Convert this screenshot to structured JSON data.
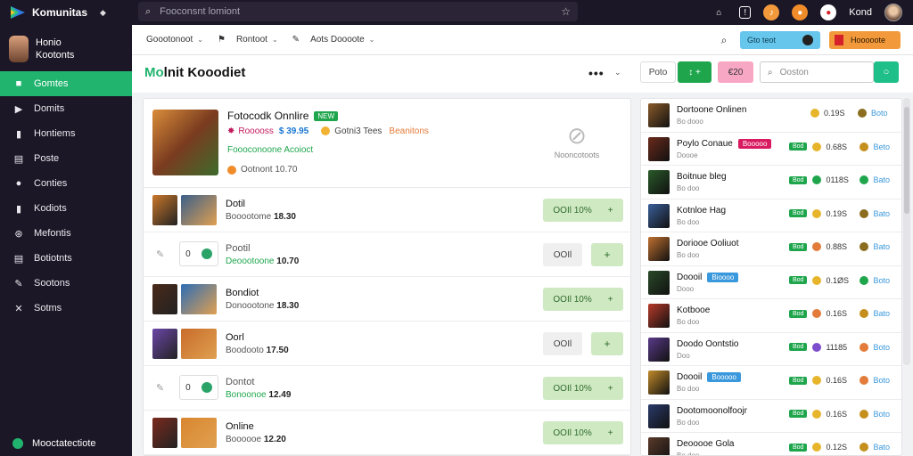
{
  "app": {
    "name": "Komunitas"
  },
  "topbar": {
    "search_placeholder": "Fooconsnt lomiont",
    "username": "Kond"
  },
  "sidebar": {
    "user": {
      "line1": "Honio",
      "line2": "Kootonts"
    },
    "items": [
      {
        "label": "Gomtes",
        "icon": "■",
        "active": true
      },
      {
        "label": "Domits",
        "icon": "▶"
      },
      {
        "label": "Hontiems",
        "icon": "▮"
      },
      {
        "label": "Poste",
        "icon": "▤"
      },
      {
        "label": "Conties",
        "icon": "●"
      },
      {
        "label": "Kodiots",
        "icon": "▮"
      },
      {
        "label": "Mefontis",
        "icon": "⊛"
      },
      {
        "label": "Botiotnts",
        "icon": "▤"
      },
      {
        "label": "Sootons",
        "icon": "✎"
      },
      {
        "label": "Sotms",
        "icon": "✕"
      }
    ],
    "footer": "Mooctatectiote"
  },
  "subbar": {
    "item1": "Goootonoot",
    "item2": "Rontoot",
    "item3": "Aots Doooote",
    "blue_pill": "Gto teot",
    "orange_pill": "Hooooote"
  },
  "titlebar": {
    "title_prefix": "Mo",
    "title_rest": "lnit Kooodiet",
    "dots": "•••",
    "btn_white": "Poto",
    "btn_green": "↕ +",
    "btn_pink": "€20",
    "search_placeholder": "Ooston"
  },
  "featured": {
    "title": "Fotocodk Onnlire",
    "badge": "NEW",
    "price_pink": "Rooooss",
    "price_blue": "$ 39.95",
    "meta_gray": "Gotni3 Tees",
    "meta_orange": "Beanitons",
    "green_line": "Foooconoone Acoioct",
    "bottom": "Ootnont 10.70",
    "side_icon": "⊘",
    "side_label": "Nooncotoots"
  },
  "rows": [
    {
      "name": "Dotil",
      "price_label": "Booootome",
      "price": "18.30",
      "variant": "thumbs",
      "btn_label": "OOIl 10%",
      "btn_plus": "+"
    },
    {
      "name": "Pootil",
      "price_label": "Deoootoone",
      "price": "10.70",
      "variant": "box",
      "box_value": "0",
      "btn_label": "OOIl",
      "btn_plus": "+"
    },
    {
      "name": "Bondiot",
      "price_label": "Donoootone",
      "price": "18.30",
      "variant": "thumbs",
      "btn_label": "OOIl 10%",
      "btn_plus": "+"
    },
    {
      "name": "Oorl",
      "price_label": "Boodooto",
      "price": "17.50",
      "variant": "thumbs",
      "btn_label": "OOIl",
      "btn_plus": "+"
    },
    {
      "name": "Dontot",
      "price_label": "Bonoonoe",
      "price": "12.49",
      "variant": "box",
      "box_value": "0",
      "btn_label": "OOIl 10%",
      "btn_plus": "+"
    },
    {
      "name": "Online",
      "price_label": "Boooooe",
      "price": "12.20",
      "variant": "thumbs",
      "btn_label": "OOIl 10%",
      "btn_plus": "+"
    }
  ],
  "rpanel": [
    {
      "name": "Dortoone Onlinen",
      "sub": "Bo dooo",
      "tag": "",
      "v1": "0.19S",
      "v2": "Boto",
      "c1": "#e7b52c",
      "c2": "#8a6d1f",
      "g": false
    },
    {
      "name": "Poylo Conaue",
      "sub": "Doooe",
      "tag": "Booooo",
      "tagc": "red",
      "v1": "0.68S",
      "v2": "Beto",
      "c1": "#e7b52c",
      "c2": "#c58f1d",
      "g": true
    },
    {
      "name": "Boitnue bleg",
      "sub": "Bo doo",
      "tag": "",
      "v1": "0118S",
      "v2": "Bato",
      "c1": "#1fa64d",
      "c2": "#1fa64d",
      "g": true
    },
    {
      "name": "Kotnloe Hag",
      "sub": "Bo doo",
      "tag": "",
      "v1": "0.19S",
      "v2": "Bato",
      "c1": "#e7b52c",
      "c2": "#8a6d1f",
      "g": true
    },
    {
      "name": "Doriooe Ooliuot",
      "sub": "Bo doo",
      "tag": "",
      "v1": "0.88S",
      "v2": "Bato",
      "c1": "#e37b3a",
      "c2": "#8a6d1f",
      "g": true
    },
    {
      "name": "Doooil",
      "sub": "Dooo",
      "tag": "Bioooo",
      "tagc": "blue",
      "v1": "0.1ØS",
      "v2": "Boto",
      "c1": "#e7b52c",
      "c2": "#1fa64d",
      "g": true
    },
    {
      "name": "Kotbooe",
      "sub": "Bo doo",
      "tag": "",
      "v1": "0.16S",
      "v2": "Bato",
      "c1": "#e37b3a",
      "c2": "#c58f1d",
      "g": true
    },
    {
      "name": "Doodo Oontstio",
      "sub": "Doo",
      "tag": "",
      "v1": "11185",
      "v2": "Boto",
      "c1": "#7c4dcc",
      "c2": "#e37b3a",
      "g": true
    },
    {
      "name": "Doooil",
      "sub": "Bo doo",
      "tag": "Booooo",
      "tagc": "blue",
      "v1": "0.16S",
      "v2": "Boto",
      "c1": "#e7b52c",
      "c2": "#e37b3a",
      "g": true
    },
    {
      "name": "Dootomoonolfoojr",
      "sub": "Bo doo",
      "tag": "",
      "v1": "0.16S",
      "v2": "Boto",
      "c1": "#e7b52c",
      "c2": "#c58f1d",
      "g": true
    },
    {
      "name": "Deooooe Gola",
      "sub": "Bo doo",
      "tag": "",
      "v1": "0.12S",
      "v2": "Bato",
      "c1": "#e7b52c",
      "c2": "#c58f1d",
      "g": true
    }
  ],
  "colors": {
    "accent": "#21b46f",
    "sidebar_bg": "#1c1726",
    "green_btn": "#1fa64d",
    "pink": "#f7a6c4",
    "blue": "#67c6ec",
    "orange": "#f29a3b"
  }
}
